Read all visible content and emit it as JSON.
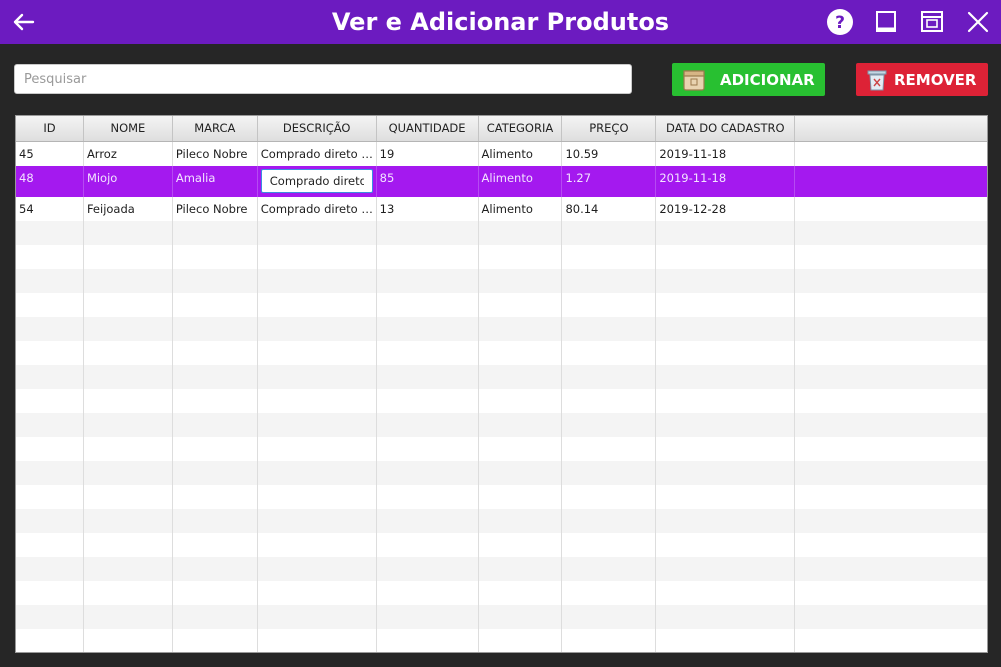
{
  "window": {
    "title": "Ver e Adicionar Produtos",
    "buttons": [
      "back-icon",
      "help-icon",
      "minimize-icon",
      "maximize-icon",
      "close-icon"
    ],
    "titlebar_color": "#6c1bc0"
  },
  "search": {
    "placeholder": "Pesquisar",
    "value": ""
  },
  "actions": {
    "add_label": "ADICIONAR",
    "add_color": "#28c031",
    "remove_label": "REMOVER",
    "remove_color": "#dd2236"
  },
  "table": {
    "columns": [
      "ID",
      "NOME",
      "MARCA",
      "DESCRIÇÃO",
      "QUANTIDADE",
      "CATEGORIA",
      "PREÇO",
      "DATA DO CADASTRO"
    ],
    "rows": [
      [
        "45",
        "Arroz",
        "Pileco Nobre",
        "Comprado direto d...",
        "19",
        "Alimento",
        "10.59",
        "2019-11-18"
      ],
      [
        "48",
        "Miojo",
        "Amalia",
        "Comprado direto d",
        "85",
        "Alimento",
        "1.27",
        "2019-11-18"
      ],
      [
        "54",
        "Feijoada",
        "Pileco Nobre",
        "Comprado direto d...",
        "13",
        "Alimento",
        "80.14",
        "2019-12-28"
      ]
    ],
    "selected_row": 1,
    "editing_cell": {
      "row": 1,
      "column": "DESCRIÇÃO",
      "value": "Comprado direto d"
    },
    "selected_color": "#a419ef"
  }
}
